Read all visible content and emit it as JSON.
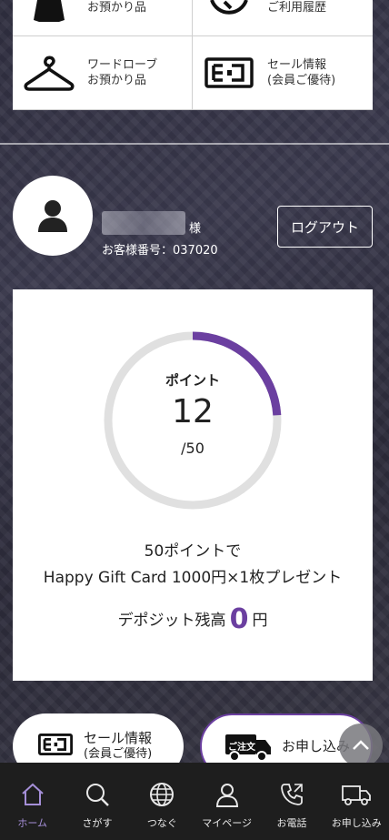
{
  "top_grid": {
    "items": [
      {
        "label": "お預かり品",
        "icon": "jacket-icon"
      },
      {
        "label": "ご利用履歴",
        "icon": "clock-icon"
      },
      {
        "label_line1": "ワードローブ",
        "label_line2": "お預かり品",
        "icon": "hanger-icon"
      },
      {
        "label_line1": "セール情報",
        "label_line2": "(会員ご優待)",
        "icon": "sale-tag-icon"
      }
    ]
  },
  "profile": {
    "name_suffix": "様",
    "customer_number": "お客様番号：037020",
    "logout_label": "ログアウト"
  },
  "points": {
    "label": "ポイント",
    "value": "12",
    "max": "/50",
    "progress_fraction": 0.24,
    "promo_line1": "50ポイントで",
    "promo_line2": "Happy Gift Card 1000円×1枚プレゼント",
    "deposit_label": "デポジット残高",
    "deposit_value": "0",
    "deposit_unit": "円"
  },
  "pills": {
    "sale_line1": "セール情報",
    "sale_line2": "(会員ご優待)",
    "apply_truck_text": "ご注文",
    "apply_label": "お申し込み"
  },
  "nav": {
    "items": [
      {
        "label": "ホーム",
        "icon": "home-icon",
        "active": true
      },
      {
        "label": "さがす",
        "icon": "search-icon"
      },
      {
        "label": "つなぐ",
        "icon": "globe-icon"
      },
      {
        "label": "マイページ",
        "icon": "user-icon"
      },
      {
        "label": "お電話",
        "icon": "phone-icon"
      },
      {
        "label": "お申し込み",
        "icon": "truck-icon"
      }
    ]
  },
  "colors": {
    "accent": "#6b3fa0",
    "nav_active": "#a58fd8",
    "nav_bg": "#1e1e1e"
  }
}
